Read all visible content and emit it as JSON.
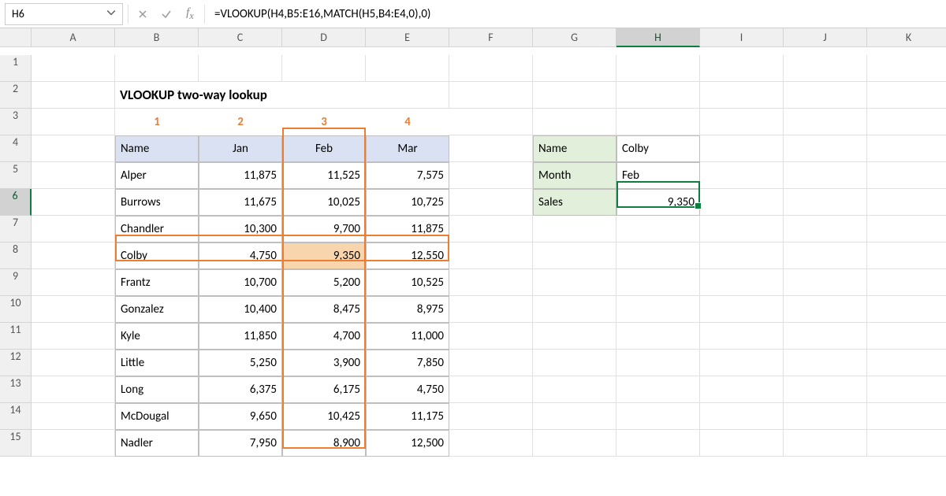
{
  "active_cell_ref": "H6",
  "formula": "=VLOOKUP(H4,B5:E16,MATCH(H5,B4:E4,0),0)",
  "columns": [
    "A",
    "B",
    "C",
    "D",
    "E",
    "F",
    "G",
    "H",
    "I",
    "J",
    "K"
  ],
  "rows": [
    "1",
    "2",
    "3",
    "4",
    "5",
    "6",
    "7",
    "8",
    "9",
    "10",
    "11",
    "12",
    "13",
    "14",
    "15"
  ],
  "title": "VLOOKUP two-way lookup",
  "colnums": [
    "1",
    "2",
    "3",
    "4"
  ],
  "table": {
    "headers": [
      "Name",
      "Jan",
      "Feb",
      "Mar"
    ],
    "rows": [
      [
        "Alper",
        "11,875",
        "11,525",
        "7,575"
      ],
      [
        "Burrows",
        "11,675",
        "10,025",
        "10,725"
      ],
      [
        "Chandler",
        "10,300",
        "9,700",
        "11,875"
      ],
      [
        "Colby",
        "4,750",
        "9,350",
        "12,550"
      ],
      [
        "Frantz",
        "10,700",
        "5,200",
        "10,525"
      ],
      [
        "Gonzalez",
        "10,400",
        "8,475",
        "8,975"
      ],
      [
        "Kyle",
        "11,850",
        "4,700",
        "11,000"
      ],
      [
        "Little",
        "5,250",
        "3,900",
        "7,850"
      ],
      [
        "Long",
        "6,375",
        "6,175",
        "4,750"
      ],
      [
        "McDougal",
        "9,650",
        "10,425",
        "11,175"
      ],
      [
        "Nadler",
        "7,950",
        "8,900",
        "12,500"
      ]
    ]
  },
  "lookup": {
    "labels": [
      "Name",
      "Month",
      "Sales"
    ],
    "values": [
      "Colby",
      "Feb",
      "9,350"
    ]
  },
  "chart_data": {
    "type": "table",
    "title": "VLOOKUP two-way lookup",
    "columns": [
      "Name",
      "Jan",
      "Feb",
      "Mar"
    ],
    "rows": [
      {
        "Name": "Alper",
        "Jan": 11875,
        "Feb": 11525,
        "Mar": 7575
      },
      {
        "Name": "Burrows",
        "Jan": 11675,
        "Feb": 10025,
        "Mar": 10725
      },
      {
        "Name": "Chandler",
        "Jan": 10300,
        "Feb": 9700,
        "Mar": 11875
      },
      {
        "Name": "Colby",
        "Jan": 4750,
        "Feb": 9350,
        "Mar": 12550
      },
      {
        "Name": "Frantz",
        "Jan": 10700,
        "Feb": 5200,
        "Mar": 10525
      },
      {
        "Name": "Gonzalez",
        "Jan": 10400,
        "Feb": 8475,
        "Mar": 8975
      },
      {
        "Name": "Kyle",
        "Jan": 11850,
        "Feb": 4700,
        "Mar": 11000
      },
      {
        "Name": "Little",
        "Jan": 5250,
        "Feb": 3900,
        "Mar": 7850
      },
      {
        "Name": "Long",
        "Jan": 6375,
        "Feb": 6175,
        "Mar": 4750
      },
      {
        "Name": "McDougal",
        "Jan": 9650,
        "Feb": 10425,
        "Mar": 11175
      },
      {
        "Name": "Nadler",
        "Jan": 7950,
        "Feb": 8900,
        "Mar": 12500
      }
    ],
    "lookup": {
      "Name": "Colby",
      "Month": "Feb",
      "Sales": 9350
    }
  }
}
